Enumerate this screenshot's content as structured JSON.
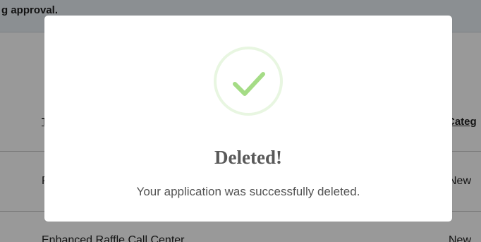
{
  "background": {
    "banner_text": "g approval.",
    "table": {
      "headers": {
        "type": "Type",
        "category": "Categ"
      },
      "rows": [
        {
          "type": "Punch Board/Pull-tab",
          "category": "New"
        },
        {
          "type": "Enhanced Raffle Call Center",
          "category": "New"
        }
      ]
    }
  },
  "dialog": {
    "icon": "success-checkmark-icon",
    "title": "Deleted!",
    "message": "Your application was successfully deleted."
  },
  "colors": {
    "overlay": "rgba(0,0,0,0.40)",
    "success_green": "#a5dc86",
    "title_text": "#595959",
    "message_text": "#545454"
  }
}
